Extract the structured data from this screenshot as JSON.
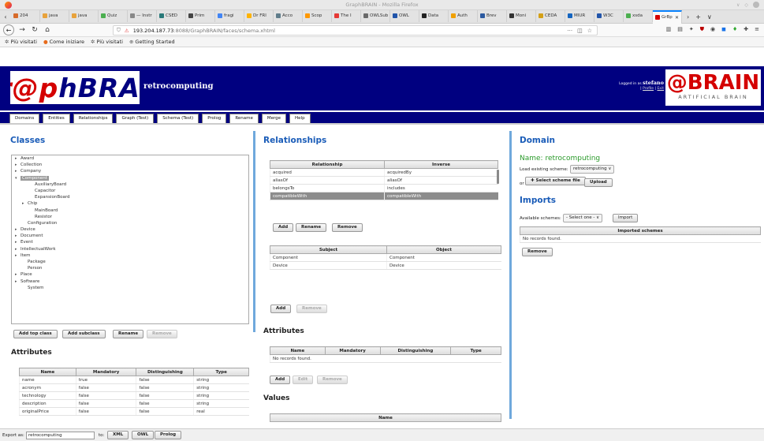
{
  "browser": {
    "window_title": "GraphBRAIN - Mozilla Firefox",
    "tabs": [
      "204",
      "java",
      "java",
      "Quiz",
      "— Instr",
      "CSED",
      "Prim",
      "fragi",
      "Dr FRI",
      "Acco",
      "Scop",
      "The I",
      "OWLSub",
      "OWL",
      "Data",
      "Auth",
      "Brev",
      "Moni",
      "CEDA",
      "MIUR",
      "W3C",
      "xsda",
      "GrBp"
    ],
    "tab_colors": [
      "#d76b2a",
      "#e8a23b",
      "#e8a23b",
      "#4caf50",
      "#888888",
      "#2a7a7a",
      "#444444",
      "#4285f4",
      "#ffb300",
      "#607d8b",
      "#ff9800",
      "#e53935",
      "#6a6a6a",
      "#2255aa",
      "#222222",
      "#f0a000",
      "#2c5aa0",
      "#333333",
      "#d4a017",
      "#1565c0",
      "#2255aa",
      "#4caf50",
      "#d40000"
    ],
    "url_host": "193.204.187.73",
    "url_path": ":8088/GraphBRAIN/faces/schema.xhtml",
    "bookmarks": [
      "Più visitati",
      "Come iniziare",
      "Più visitati",
      "Getting Started"
    ]
  },
  "app": {
    "logo_red": "Gr@p",
    "logo_blue": "hBRAIN",
    "db_name": "retrocomputing",
    "logged_prefix": "Logged in as",
    "user": "stefano",
    "profile": "Profile",
    "exit": "Exit",
    "brand": "@BRAIN",
    "brand_sub": "ARTIFICIAL BRAIN",
    "menu": [
      "Domains",
      "Entities",
      "Relationships",
      "Graph (Test)",
      "Schema (Test)",
      "Prolog",
      "Rename",
      "Merge",
      "Help"
    ]
  },
  "classes": {
    "title": "Classes",
    "tree": [
      {
        "label": "Award",
        "level": 0,
        "arrow": "▸"
      },
      {
        "label": "Collection",
        "level": 0,
        "arrow": "▸"
      },
      {
        "label": "Company",
        "level": 0,
        "arrow": "▸"
      },
      {
        "label": "Component",
        "level": 0,
        "arrow": "▾",
        "selected": true
      },
      {
        "label": "AuxiliaryBoard",
        "level": 2,
        "arrow": ""
      },
      {
        "label": "Capacitor",
        "level": 2,
        "arrow": ""
      },
      {
        "label": "ExpansionBoard",
        "level": 2,
        "arrow": ""
      },
      {
        "label": "Chip",
        "level": 1,
        "arrow": "▸"
      },
      {
        "label": "MainBoard",
        "level": 2,
        "arrow": ""
      },
      {
        "label": "Resistor",
        "level": 2,
        "arrow": ""
      },
      {
        "label": "Configuration",
        "level": 1,
        "arrow": ""
      },
      {
        "label": "Device",
        "level": 0,
        "arrow": "▸"
      },
      {
        "label": "Document",
        "level": 0,
        "arrow": "▸"
      },
      {
        "label": "Event",
        "level": 0,
        "arrow": "▸"
      },
      {
        "label": "IntellectualWork",
        "level": 0,
        "arrow": "▸"
      },
      {
        "label": "Item",
        "level": 0,
        "arrow": "▸"
      },
      {
        "label": "Package",
        "level": 1,
        "arrow": ""
      },
      {
        "label": "Person",
        "level": 1,
        "arrow": ""
      },
      {
        "label": "Place",
        "level": 0,
        "arrow": "▸"
      },
      {
        "label": "Software",
        "level": 0,
        "arrow": "▸"
      },
      {
        "label": "System",
        "level": 1,
        "arrow": ""
      }
    ],
    "buttons": {
      "add_top": "Add top class",
      "add_sub": "Add subclass",
      "rename": "Rename",
      "remove": "Remove"
    },
    "attributes_title": "Attributes",
    "attr_headers": [
      "Name",
      "Mandatory",
      "Distinguishing",
      "Type"
    ],
    "attr_rows": [
      [
        "name",
        "true",
        "false",
        "string"
      ],
      [
        "acronym",
        "false",
        "false",
        "string"
      ],
      [
        "technology",
        "false",
        "false",
        "string"
      ],
      [
        "description",
        "false",
        "false",
        "string"
      ],
      [
        "originalPrice",
        "false",
        "false",
        "real"
      ]
    ]
  },
  "relationships": {
    "title": "Relationships",
    "headers": [
      "Relationship",
      "Inverse"
    ],
    "rows": [
      [
        "acquired",
        "acquiredBy"
      ],
      [
        "aliasOf",
        "aliasOf"
      ],
      [
        "belongsTo",
        "includes"
      ],
      [
        "compatibleWith",
        "compatibleWith"
      ]
    ],
    "buttons": {
      "add": "Add",
      "rename": "Rename",
      "remove": "Remove"
    },
    "so_headers": [
      "Subject",
      "Object"
    ],
    "so_rows": [
      [
        "Component",
        "Component"
      ],
      [
        "Device",
        "Device"
      ]
    ],
    "so_buttons": {
      "add": "Add",
      "remove": "Remove"
    },
    "attributes_title": "Attributes",
    "attr_headers": [
      "Name",
      "Mandatory",
      "Distinguishing",
      "Type"
    ],
    "attr_empty": "No records found.",
    "attr_buttons": {
      "add": "Add",
      "edit": "Edit",
      "remove": "Remove"
    },
    "values_title": "Values",
    "values_header": "Name"
  },
  "domain": {
    "title": "Domain",
    "name_label": "Name: retrocomputing",
    "load_label": "Load existing scheme:",
    "load_value": "retrocomputing",
    "or_label": "or",
    "select_file": "Select scheme file",
    "upload": "Upload",
    "imports_title": "Imports",
    "available_label": "Available schemes:",
    "available_value": "- Select one -",
    "import_btn": "Import",
    "imported_header": "Imported schemes",
    "imported_empty": "No records found.",
    "remove": "Remove"
  },
  "footer": {
    "export_label": "Export as:",
    "export_value": "retrocomputing",
    "to_label": "to:",
    "xml": "XML",
    "owl": "OWL",
    "prolog": "Prolog"
  }
}
